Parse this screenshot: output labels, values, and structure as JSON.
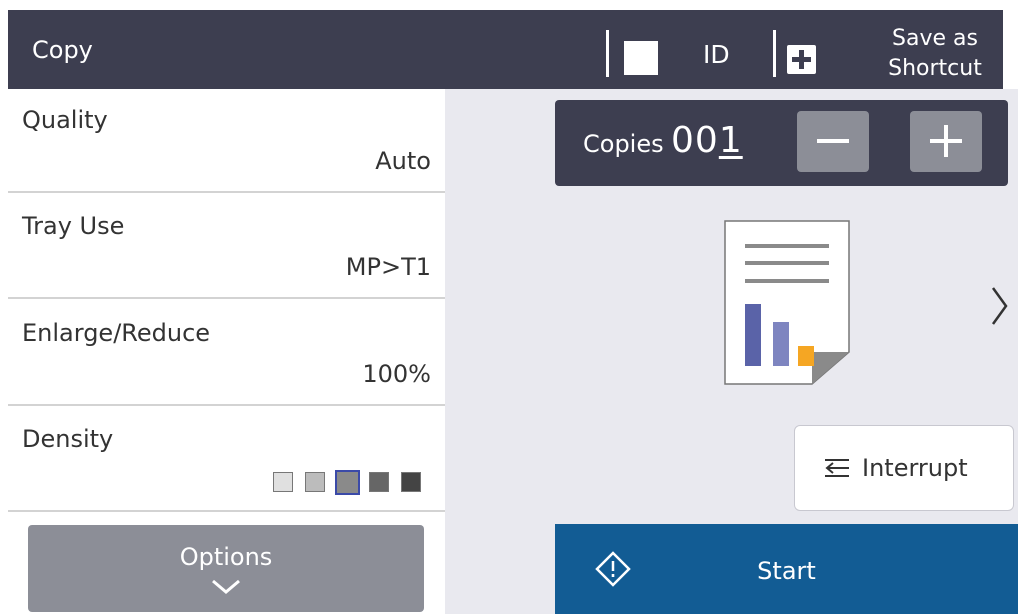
{
  "header": {
    "title": "Copy",
    "id_label": "ID",
    "save_as_line1": "Save as",
    "save_as_line2": "Shortcut"
  },
  "settings": [
    {
      "label": "Quality",
      "value": "Auto"
    },
    {
      "label": "Tray Use",
      "value": "MP>T1"
    },
    {
      "label": "Enlarge/Reduce",
      "value": "100%"
    },
    {
      "label": "Density",
      "value": ""
    }
  ],
  "density": {
    "levels": 5,
    "selected_index": 2,
    "cell_colors": [
      "#e0e0e0",
      "#bcbcbc",
      "#8a8a8a",
      "#666666",
      "#444444"
    ],
    "selected_border_color": "#3b4aa8"
  },
  "options_button": {
    "label": "Options"
  },
  "copies": {
    "label": "Copies",
    "value_prefix": "00",
    "value_cursor_digit": "1"
  },
  "interrupt_button": {
    "label": "Interrupt"
  },
  "start_button": {
    "label": "Start"
  },
  "icons": {
    "id_copy": "white-square-icon",
    "save_shortcut": "plus-box-icon",
    "decrease": "minus-icon",
    "increase": "plus-icon",
    "preview": "document-preview-icon",
    "next": "chevron-right-icon",
    "options": "chevron-down-icon",
    "interrupt": "interrupt-icon",
    "start": "start-diamond-icon"
  },
  "colors": {
    "header_bg": "#3d3e50",
    "panel_bg": "#e9e9ef",
    "button_gray": "#8c8e97",
    "start_blue": "#125c94",
    "preview_bar_blue": "#5a63a8",
    "preview_bar_light": "#7e85c0",
    "preview_bar_orange": "#f5a623"
  }
}
